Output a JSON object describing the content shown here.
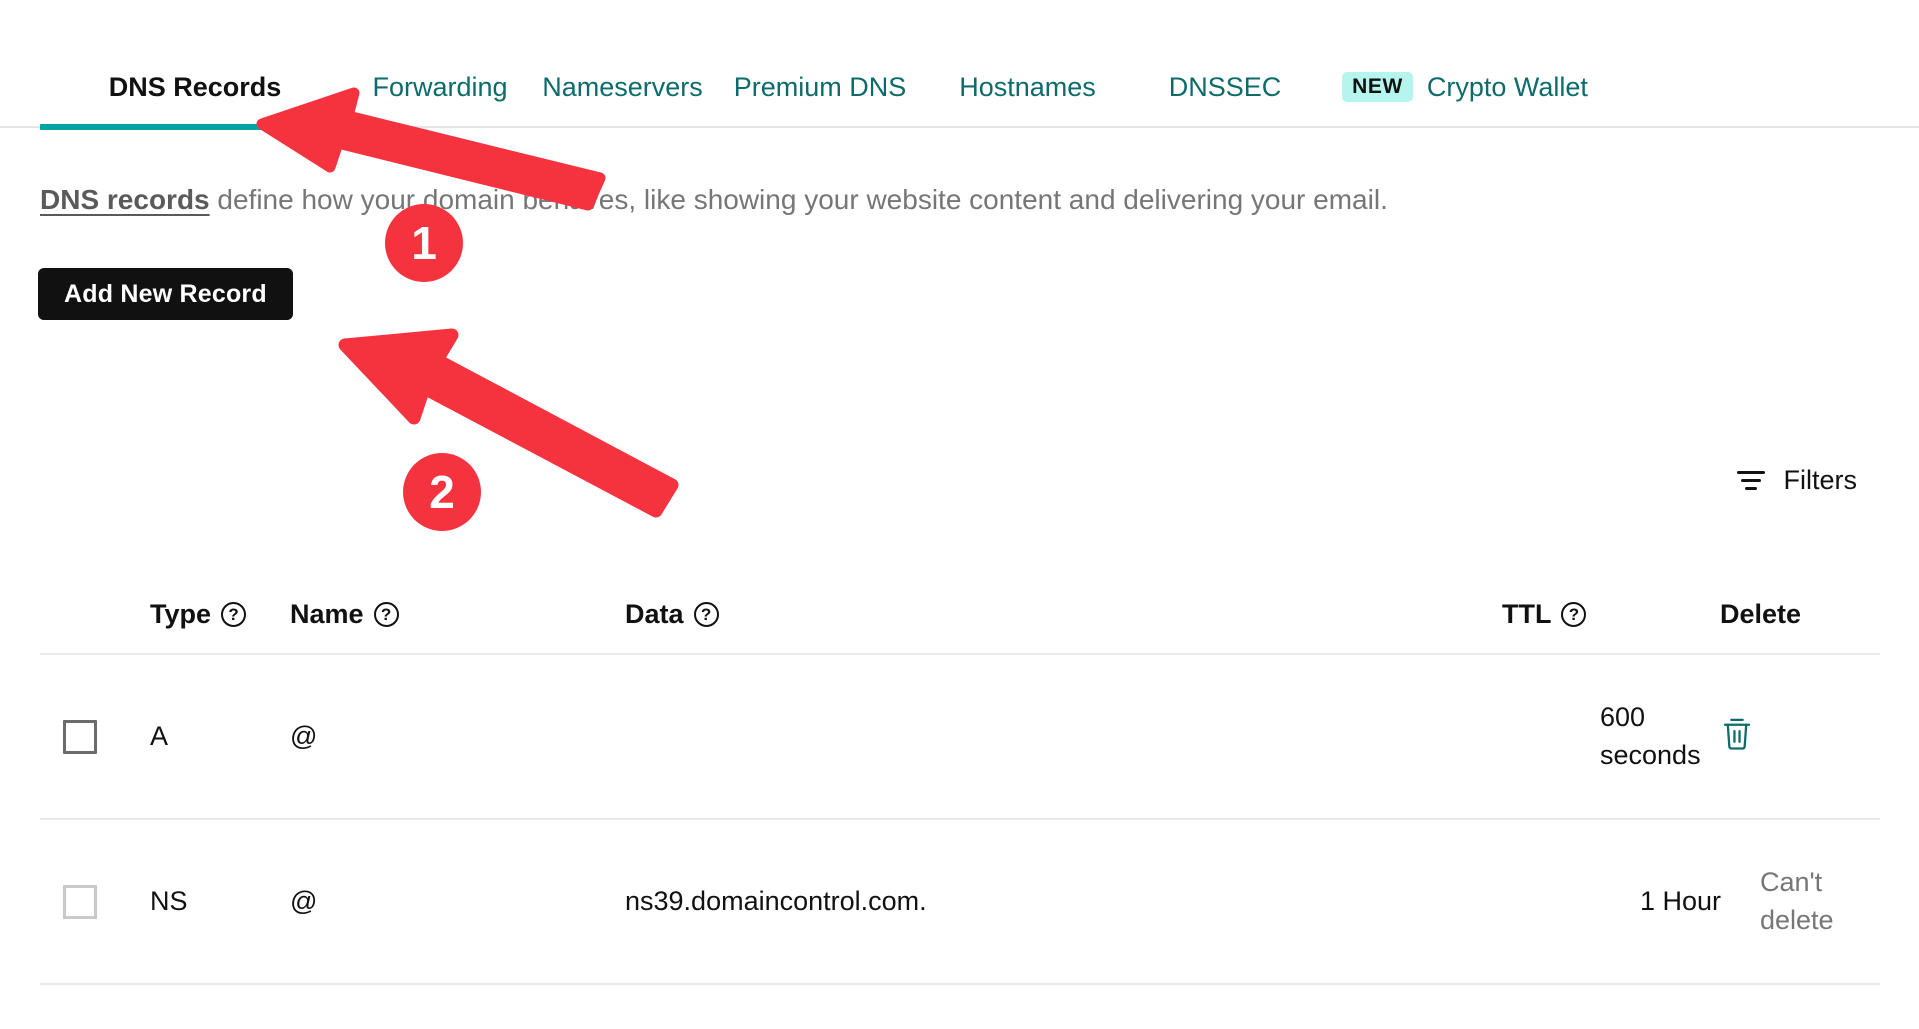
{
  "tabs": [
    {
      "label": "DNS Records",
      "active": true,
      "badge": null
    },
    {
      "label": "Forwarding",
      "active": false,
      "badge": null
    },
    {
      "label": "Nameservers",
      "active": false,
      "badge": null
    },
    {
      "label": "Premium DNS",
      "active": false,
      "badge": null
    },
    {
      "label": "Hostnames",
      "active": false,
      "badge": null
    },
    {
      "label": "DNSSEC",
      "active": false,
      "badge": null
    },
    {
      "label": "Crypto Wallet",
      "active": false,
      "badge": "NEW"
    }
  ],
  "description": {
    "link_text": "DNS records",
    "rest_text": " define how your domain behaves, like showing your website content and delivering your email."
  },
  "add_button": {
    "label": "Add New Record"
  },
  "filters": {
    "label": "Filters",
    "icon": "filter-icon"
  },
  "table": {
    "columns": [
      {
        "key": "check",
        "label": "",
        "help": false
      },
      {
        "key": "type",
        "label": "Type",
        "help": true
      },
      {
        "key": "name",
        "label": "Name",
        "help": true
      },
      {
        "key": "data",
        "label": "Data",
        "help": true
      },
      {
        "key": "ttl",
        "label": "TTL",
        "help": true
      },
      {
        "key": "delete",
        "label": "Delete",
        "help": false
      }
    ],
    "help_glyph": "?",
    "rows": [
      {
        "type": "A",
        "name": "@",
        "data": "",
        "data_redacted": true,
        "ttl": "600 seconds",
        "delete_label": "",
        "deletable": true
      },
      {
        "type": "NS",
        "name": "@",
        "data": "ns39.domaincontrol.com.",
        "data_redacted": false,
        "ttl": "1 Hour",
        "delete_label": "Can't delete",
        "deletable": false
      }
    ]
  },
  "annotations": [
    {
      "number": "1",
      "target": "dns-records-tab"
    },
    {
      "number": "2",
      "target": "add-new-record-button"
    }
  ],
  "colors": {
    "accent_teal": "#00a4a6",
    "tab_link": "#0d6b6b",
    "annotation_red": "#f5333f",
    "badge_new_bg": "#b6f5ee",
    "button_black": "#111111",
    "muted_text": "#767676"
  }
}
